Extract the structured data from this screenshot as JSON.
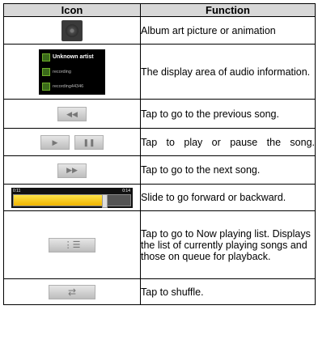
{
  "table": {
    "header": {
      "icon": "Icon",
      "function": "Function"
    },
    "rows": [
      {
        "icon": "album-art-icon",
        "function": "Album art picture or animation"
      },
      {
        "icon": "audio-info-panel",
        "function": "The display area of audio information.",
        "panel": {
          "artist": "Unknown artist",
          "album": "recording",
          "track": "recording44346"
        }
      },
      {
        "icon": "previous-icon",
        "function": "Tap to go to the previous song."
      },
      {
        "icon": "play-pause-icon",
        "function": "Tap to play or pause the song."
      },
      {
        "icon": "next-icon",
        "function": "Tap to go to the next song."
      },
      {
        "icon": "seek-bar",
        "function": "Slide to go forward or backward.",
        "seek": {
          "elapsed": "0:11",
          "total": "0:14",
          "progress": 0.78
        }
      },
      {
        "icon": "now-playing-list-icon",
        "function": "Tap to go to Now playing list. Displays the list of currently playing songs and those on queue for playback."
      },
      {
        "icon": "shuffle-icon",
        "function": "Tap to shuffle."
      }
    ]
  },
  "colors": {
    "header_bg": "#d8d8d8",
    "seek_fill": "#f0b400"
  }
}
